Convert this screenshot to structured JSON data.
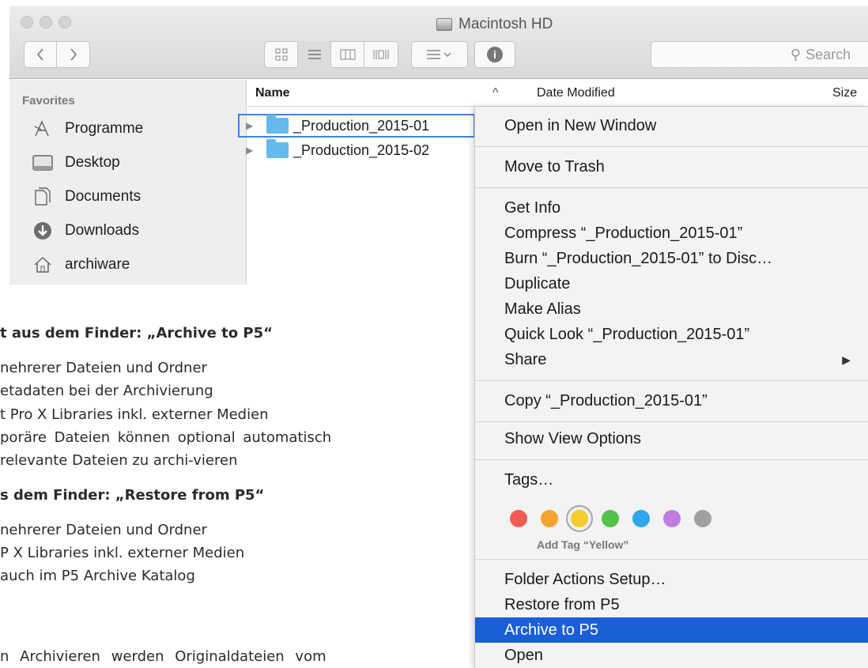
{
  "window": {
    "title": "Macintosh HD",
    "search_placeholder": "Search",
    "info_glyph": "i"
  },
  "sidebar": {
    "header": "Favorites",
    "items": [
      {
        "label": "Programme",
        "icon": "applications-icon"
      },
      {
        "label": "Desktop",
        "icon": "desktop-icon"
      },
      {
        "label": "Documents",
        "icon": "documents-icon"
      },
      {
        "label": "Downloads",
        "icon": "downloads-icon"
      },
      {
        "label": "archiware",
        "icon": "home-icon"
      }
    ]
  },
  "list": {
    "columns": {
      "name": "Name",
      "date": "Date Modified",
      "size": "Size"
    },
    "rows": [
      {
        "name": "_Production_2015-01",
        "selected": true
      },
      {
        "name": "_Production_2015-02",
        "selected": false
      }
    ]
  },
  "document": {
    "lines": [
      "t aus dem Finder: „Archive to P5“",
      "nehrerer Dateien und Ordner",
      "etadaten bei der Archivierung",
      "t Pro X Libraries inkl. externer Medien",
      "poräre Dateien können optional automatisch",
      "relevante Dateien zu archi-vieren",
      "s dem Finder: „Restore from P5“",
      "nehrerer Dateien und Ordner",
      "P X Libraries inkl. externer Medien",
      "auch im P5 Archive Katalog",
      "n Archivieren werden Originaldateien vom"
    ]
  },
  "menu": {
    "items": {
      "open_new_window": "Open in New Window",
      "move_to_trash": "Move to Trash",
      "get_info": "Get Info",
      "compress": "Compress “_Production_2015-01”",
      "burn": "Burn “_Production_2015-01” to Disc…",
      "duplicate": "Duplicate",
      "make_alias": "Make Alias",
      "quick_look": "Quick Look “_Production_2015-01”",
      "share": "Share",
      "copy": "Copy “_Production_2015-01”",
      "show_view_options": "Show View Options",
      "tags": "Tags…",
      "folder_actions": "Folder Actions Setup…",
      "restore": "Restore from P5",
      "archive": "Archive to P5",
      "open": "Open"
    },
    "tag_hint": "Add Tag “Yellow”",
    "tag_colors": [
      "#f15b52",
      "#f6a22e",
      "#f5cc2c",
      "#52c24a",
      "#2ea6f0",
      "#c07ce0",
      "#a0a0a0"
    ]
  }
}
